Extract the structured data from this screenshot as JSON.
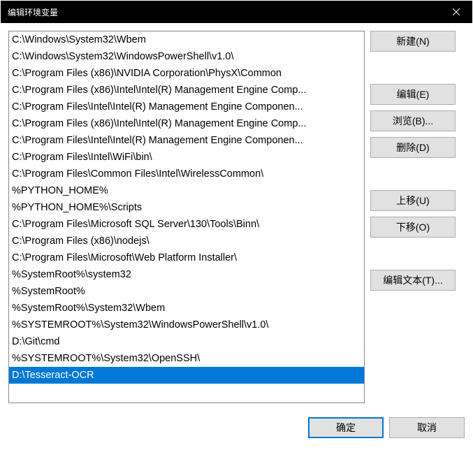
{
  "title": "编辑环境变量",
  "list_items": [
    "C:\\Windows\\System32\\Wbem",
    "C:\\Windows\\System32\\WindowsPowerShell\\v1.0\\",
    "C:\\Program Files (x86)\\NVIDIA Corporation\\PhysX\\Common",
    "C:\\Program Files (x86)\\Intel\\Intel(R) Management Engine Comp...",
    "C:\\Program Files\\Intel\\Intel(R) Management Engine Componen...",
    "C:\\Program Files (x86)\\Intel\\Intel(R) Management Engine Comp...",
    "C:\\Program Files\\Intel\\Intel(R) Management Engine Componen...",
    "C:\\Program Files\\Intel\\WiFi\\bin\\",
    "C:\\Program Files\\Common Files\\Intel\\WirelessCommon\\",
    "%PYTHON_HOME%",
    "%PYTHON_HOME%\\Scripts",
    "C:\\Program Files\\Microsoft SQL Server\\130\\Tools\\Binn\\",
    "C:\\Program Files (x86)\\nodejs\\",
    "C:\\Program Files\\Microsoft\\Web Platform Installer\\",
    "%SystemRoot%\\system32",
    "%SystemRoot%",
    "%SystemRoot%\\System32\\Wbem",
    "%SYSTEMROOT%\\System32\\WindowsPowerShell\\v1.0\\",
    "D:\\Git\\cmd",
    "%SYSTEMROOT%\\System32\\OpenSSH\\",
    "D:\\Tesseract-OCR"
  ],
  "selected_index": 20,
  "buttons": {
    "new": "新建(N)",
    "edit": "编辑(E)",
    "browse": "浏览(B)...",
    "delete": "删除(D)",
    "moveup": "上移(U)",
    "movedown": "下移(O)",
    "edittext": "编辑文本(T)..."
  },
  "footer": {
    "ok": "确定",
    "cancel": "取消"
  },
  "annotation_color": "#ff0000"
}
